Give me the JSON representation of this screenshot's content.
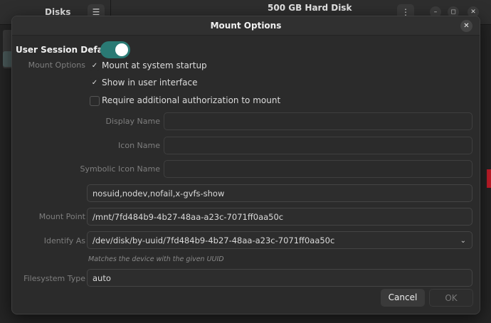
{
  "background_window": {
    "app_title": "Disks",
    "title": "500 GB Hard Disk",
    "window_buttons": [
      "–",
      "◻",
      "✕"
    ]
  },
  "dialog": {
    "title": "Mount Options",
    "close_glyph": "✕",
    "user_session_defaults": {
      "label": "User Session Defaults",
      "enabled": true
    },
    "mount_options_label": "Mount Options",
    "checkboxes": [
      {
        "label": "Mount at system startup",
        "checked": true
      },
      {
        "label": "Show in user interface",
        "checked": true
      },
      {
        "label": "Require additional authorization to mount",
        "checked": false
      }
    ],
    "fields": {
      "display_name": {
        "label": "Display Name",
        "value": ""
      },
      "icon_name": {
        "label": "Icon Name",
        "value": ""
      },
      "symbolic_icon_name": {
        "label": "Symbolic Icon Name",
        "value": ""
      },
      "options": {
        "value": "nosuid,nodev,nofail,x-gvfs-show"
      },
      "mount_point": {
        "label": "Mount Point",
        "value": "/mnt/7fd484b9-4b27-48aa-a23c-7071ff0aa50c"
      },
      "identify_as": {
        "label": "Identify As",
        "value": "/dev/disk/by-uuid/7fd484b9-4b27-48aa-a23c-7071ff0aa50c",
        "hint": "Matches the device with the given UUID"
      },
      "filesystem_type": {
        "label": "Filesystem Type",
        "value": "auto"
      }
    },
    "buttons": {
      "cancel": "Cancel",
      "ok": "OK"
    }
  },
  "colors": {
    "toggle_on": "#2a7a74",
    "dialog_bg": "#2b2b2b"
  }
}
